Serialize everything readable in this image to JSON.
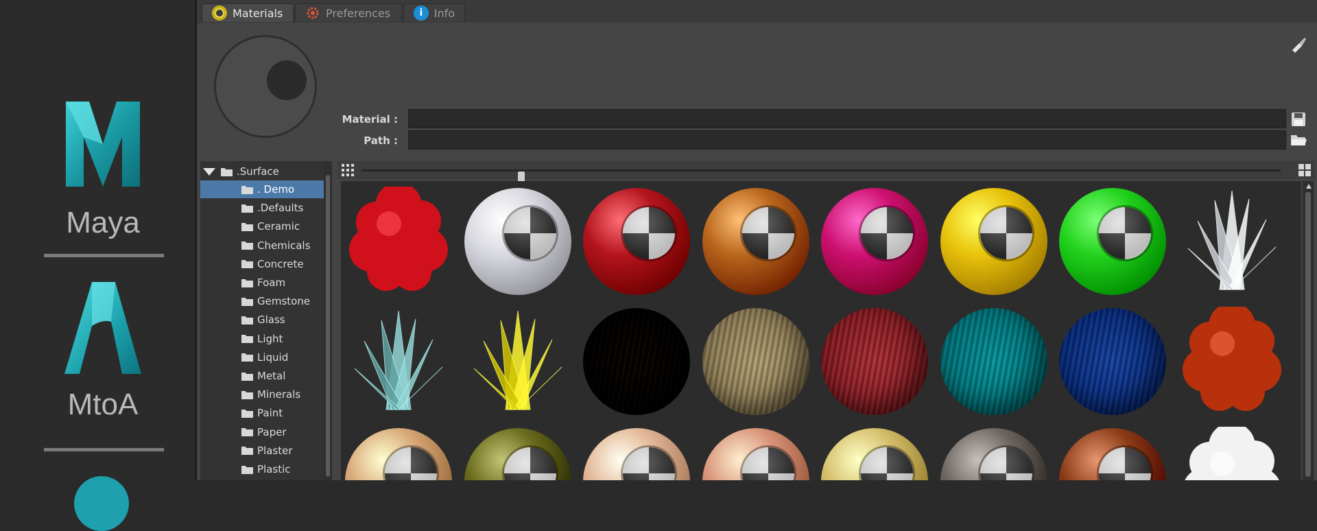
{
  "brand": {
    "maya_label": "Maya",
    "mtoa_label": "MtoA"
  },
  "tabs": [
    {
      "label": "Materials",
      "icon": "materials-icon",
      "active": true
    },
    {
      "label": "Preferences",
      "icon": "gear-icon",
      "active": false
    },
    {
      "label": "Info",
      "icon": "info-icon",
      "active": false
    }
  ],
  "header": {
    "material_label": "Material :",
    "material_value": "",
    "path_label": "Path :",
    "path_value": ""
  },
  "tree": {
    "root": ".Surface",
    "items": [
      ". Demo",
      ".Defaults",
      "Ceramic",
      "Chemicals",
      "Concrete",
      "Foam",
      "Gemstone",
      "Glass",
      "Light",
      "Liquid",
      "Metal",
      "Minerals",
      "Paint",
      "Paper",
      "Plaster",
      "Plastic"
    ],
    "selected": ". Demo"
  },
  "thumbnail_size_fraction": 0.17,
  "materials": [
    {
      "name": "red-coral",
      "style": "coral",
      "color": "#d0101a"
    },
    {
      "name": "chrome-glass",
      "style": "sphere",
      "color": "#d8d8e0"
    },
    {
      "name": "red-metallic",
      "style": "sphere",
      "color": "#b3141c"
    },
    {
      "name": "copper-metallic",
      "style": "sphere",
      "color": "#b8661c"
    },
    {
      "name": "magenta-metallic",
      "style": "sphere",
      "color": "#cc1070"
    },
    {
      "name": "yellow-plastic",
      "style": "sphere",
      "color": "#e8c20a"
    },
    {
      "name": "green-plastic",
      "style": "sphere",
      "color": "#22d21c"
    },
    {
      "name": "clear-crystal",
      "style": "crystal",
      "color": "#e8eef4"
    },
    {
      "name": "teal-crystal",
      "style": "crystal",
      "color": "#7ec0c0"
    },
    {
      "name": "yellow-crystal",
      "style": "crystal",
      "color": "#f0e21c"
    },
    {
      "name": "dark-fur",
      "style": "fur",
      "color": "#2e2219"
    },
    {
      "name": "cream-fur",
      "style": "fur",
      "color": "#c9bea2"
    },
    {
      "name": "pink-fur",
      "style": "fur",
      "color": "#c56a72"
    },
    {
      "name": "cyan-fur",
      "style": "fur",
      "color": "#2fb8bc"
    },
    {
      "name": "blue-fur",
      "style": "fur",
      "color": "#4a7cbe"
    },
    {
      "name": "orange-coral",
      "style": "coral",
      "color": "#b8300c"
    },
    {
      "name": "gold-satin",
      "style": "sphere",
      "color": "#d8a878"
    },
    {
      "name": "olive-metal",
      "style": "sphere",
      "color": "#6a6a1c"
    },
    {
      "name": "peach-satin",
      "style": "sphere",
      "color": "#e2b696"
    },
    {
      "name": "rose-gold",
      "style": "sphere",
      "color": "#d89478"
    },
    {
      "name": "gold-metal",
      "style": "sphere",
      "color": "#d4be6c"
    },
    {
      "name": "dark-steel",
      "style": "sphere",
      "color": "#6e6660"
    },
    {
      "name": "brown-clay",
      "style": "sphere",
      "color": "#8c3c16"
    },
    {
      "name": "white-foam",
      "style": "coral",
      "color": "#f2f2f2"
    }
  ]
}
